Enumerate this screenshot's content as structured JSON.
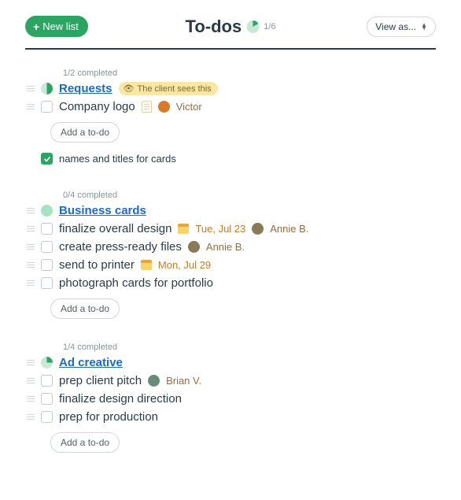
{
  "header": {
    "new_list_label": "New list",
    "title": "To-dos",
    "ratio": "1/6",
    "view_as_label": "View as..."
  },
  "lists": [
    {
      "completed_text": "1/2 completed",
      "title": "Requests",
      "client_badge": "The client sees this",
      "pie_class": "pie-half",
      "todos": [
        {
          "label": "Company logo",
          "has_doc": true,
          "assignee": "Victor",
          "avatar_class": "avatar-v"
        }
      ],
      "add_label": "Add a to-do",
      "completed_items": [
        {
          "label": "names and titles for cards"
        }
      ]
    },
    {
      "completed_text": "0/4 completed",
      "title": "Business cards",
      "pie_class": "pie-empty",
      "todos": [
        {
          "label": "finalize overall design",
          "date": "Tue, Jul 23",
          "assignee": "Annie B.",
          "avatar_class": "avatar-a"
        },
        {
          "label": "create press-ready files",
          "assignee": "Annie B.",
          "avatar_class": "avatar-a"
        },
        {
          "label": "send to printer",
          "date": "Mon, Jul 29"
        },
        {
          "label": "photograph cards for portfolio"
        }
      ],
      "add_label": "Add a to-do"
    },
    {
      "completed_text": "1/4 completed",
      "title": "Ad creative",
      "pie_class": "pie-quarter",
      "todos": [
        {
          "label": "prep client pitch",
          "assignee": "Brian V.",
          "avatar_class": "avatar-b"
        },
        {
          "label": "finalize design direction"
        },
        {
          "label": "prep for production"
        }
      ],
      "add_label": "Add a to-do"
    }
  ]
}
